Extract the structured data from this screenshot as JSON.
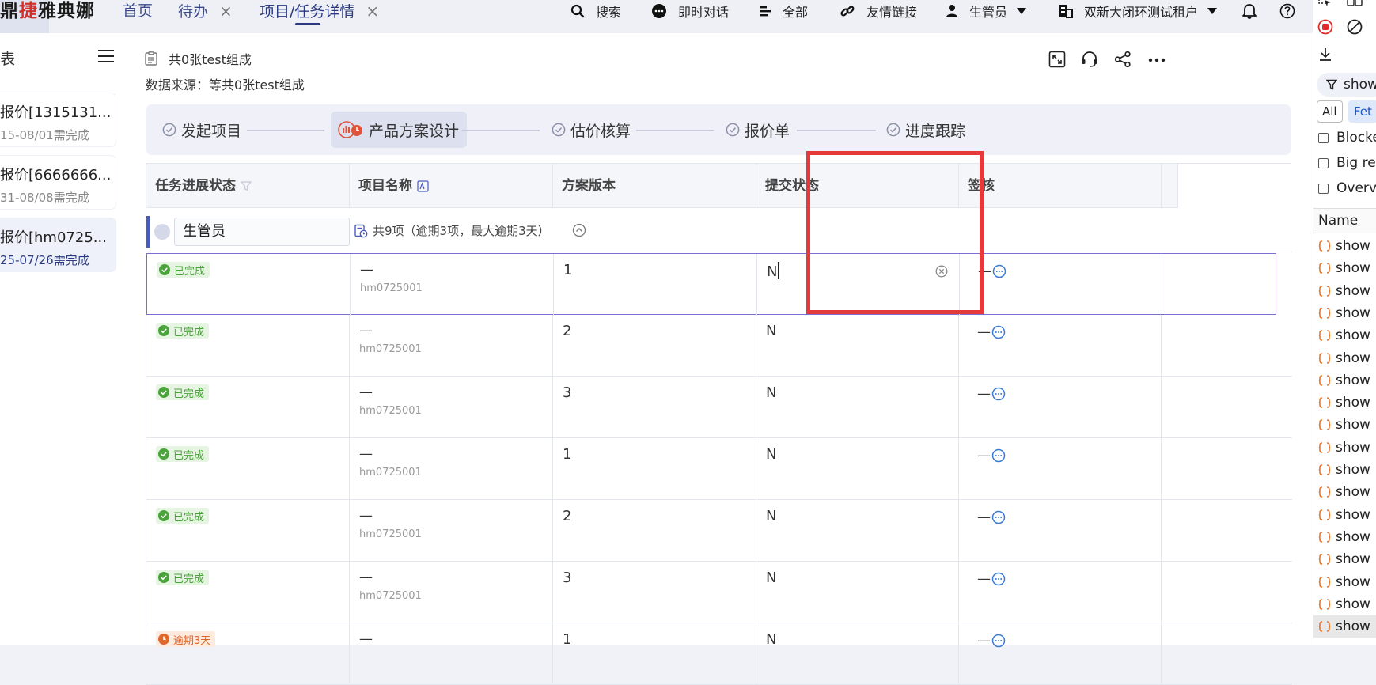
{
  "brand": {
    "prefix": "鼎",
    "highlight": "捷",
    "suffix": "雅典娜"
  },
  "nav": {
    "tabs": [
      {
        "label": "首页",
        "closable": false
      },
      {
        "label": "待办",
        "closable": true
      },
      {
        "label": "项目/任务详情",
        "closable": true,
        "active": true
      }
    ],
    "close_glyph": "×"
  },
  "toolbar": {
    "search": "搜索",
    "chat": "即时对话",
    "all": "全部",
    "links": "友情链接",
    "user": "生管员",
    "tenant": "双新大闭环测试租户"
  },
  "left": {
    "title": "表",
    "cards": [
      {
        "title": "报价[1315131...",
        "sub": "15-08/01需完成",
        "selected": false
      },
      {
        "title": "报价[6666666...",
        "sub": "31-08/08需完成",
        "selected": false
      },
      {
        "title": "报价[hm0725...",
        "sub": "25-07/26需完成",
        "selected": true
      }
    ]
  },
  "header": {
    "title": "共0张test组成",
    "source": "数据来源：等共0张test组成"
  },
  "steps": [
    {
      "label": "发起项目",
      "active": false
    },
    {
      "label": "产品方案设计",
      "active": true
    },
    {
      "label": "估价核算",
      "active": false
    },
    {
      "label": "报价单",
      "active": false
    },
    {
      "label": "进度跟踪",
      "active": false
    }
  ],
  "table": {
    "columns": [
      "任务进展状态",
      "项目名称",
      "方案版本",
      "提交状态",
      "签核"
    ],
    "group": {
      "owner": "生管员",
      "summary": "共9项（逾期3项，最大逾期3天）"
    },
    "rows": [
      {
        "status": "已完成",
        "status_kind": "done",
        "name": "—",
        "code": "hm0725001",
        "version": "1",
        "submit": "N",
        "sign": "—",
        "editing": true
      },
      {
        "status": "已完成",
        "status_kind": "done",
        "name": "—",
        "code": "hm0725001",
        "version": "2",
        "submit": "N",
        "sign": "—"
      },
      {
        "status": "已完成",
        "status_kind": "done",
        "name": "—",
        "code": "hm0725001",
        "version": "3",
        "submit": "N",
        "sign": "—"
      },
      {
        "status": "已完成",
        "status_kind": "done",
        "name": "—",
        "code": "hm0725001",
        "version": "1",
        "submit": "N",
        "sign": "—"
      },
      {
        "status": "已完成",
        "status_kind": "done",
        "name": "—",
        "code": "hm0725001",
        "version": "2",
        "submit": "N",
        "sign": "—"
      },
      {
        "status": "已完成",
        "status_kind": "done",
        "name": "—",
        "code": "hm0725001",
        "version": "3",
        "submit": "N",
        "sign": "—"
      },
      {
        "status": "逾期3天",
        "status_kind": "late",
        "name": "—",
        "code": "",
        "version": "1",
        "submit": "N",
        "sign": "—"
      }
    ]
  },
  "devtools": {
    "filter": "show",
    "chips": [
      "All",
      "Fet"
    ],
    "checks": [
      "Blocke",
      "Big re",
      "Overv"
    ],
    "header": "Name",
    "entries": [
      "show",
      "show",
      "show",
      "show",
      "show",
      "show",
      "show",
      "show",
      "show",
      "show",
      "show",
      "show",
      "show",
      "show",
      "show",
      "show",
      "show",
      "show"
    ]
  },
  "colors": {
    "accent": "#2b3a80",
    "done": "#4aa33b",
    "late": "#e0662a",
    "highlight": "#e63a3a",
    "record": "#e02d2d"
  }
}
